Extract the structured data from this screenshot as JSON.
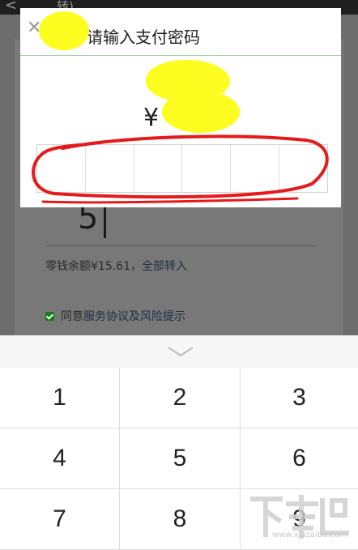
{
  "background_page": {
    "back_arrow": "<",
    "title_partial": "转)",
    "amount_digit": "5",
    "balance_text": "零钱余额¥15.61，",
    "balance_link": "全部转入",
    "agree_prefix": "同意",
    "agree_link": "服务协议及风险提示"
  },
  "dialog": {
    "close_icon": "close-icon",
    "title": "请输入支付密码",
    "currency_symbol": "¥",
    "password_cells": 6
  },
  "keypad": {
    "collapse_icon": "chevron-down-icon",
    "keys": [
      "1",
      "2",
      "3",
      "4",
      "5",
      "6",
      "7",
      "8",
      "9"
    ]
  },
  "watermark": {
    "logo_text": "下载吧",
    "url": "www.xiazaiba.com"
  },
  "colors": {
    "accent_green": "#9fd79f",
    "annotation_red": "#e51a1a",
    "redaction_yellow": "#fdfd20",
    "overlay": "#6f6f6f"
  }
}
